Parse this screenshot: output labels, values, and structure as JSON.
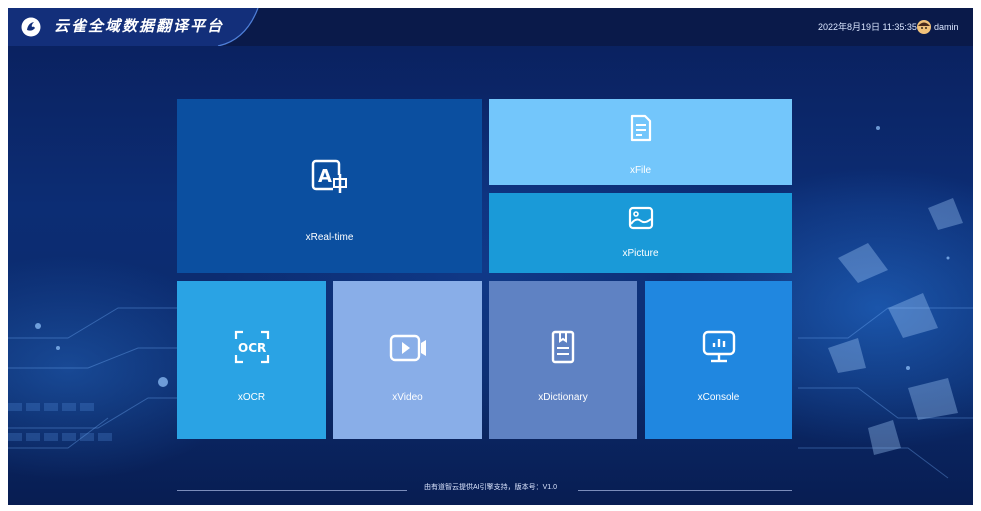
{
  "header": {
    "title": "云雀全域数据翻译平台",
    "datetime": "2022年8月19日 11:35:35",
    "username": "damin",
    "logo_icon": "bird-logo-icon",
    "avatar_icon": "user-avatar-icon"
  },
  "tiles": {
    "realtime": {
      "label": "xReal-time",
      "icon": "translate-icon",
      "color": "#0b4fa0"
    },
    "file": {
      "label": "xFile",
      "icon": "document-icon",
      "color": "#73c6fb"
    },
    "picture": {
      "label": "xPicture",
      "icon": "image-icon",
      "color": "#1a9ad8"
    },
    "ocr": {
      "label": "xOCR",
      "icon": "ocr-scan-icon",
      "color": "#2aa3e4"
    },
    "video": {
      "label": "xVideo",
      "icon": "video-icon",
      "color": "#89aee8"
    },
    "dictionary": {
      "label": "xDictionary",
      "icon": "dictionary-icon",
      "color": "#5f82c3"
    },
    "console": {
      "label": "xConsole",
      "icon": "monitor-chart-icon",
      "color": "#2087e0"
    }
  },
  "footer": {
    "text": "由有道智云提供AI引擎支持，版本号：V1.0"
  }
}
